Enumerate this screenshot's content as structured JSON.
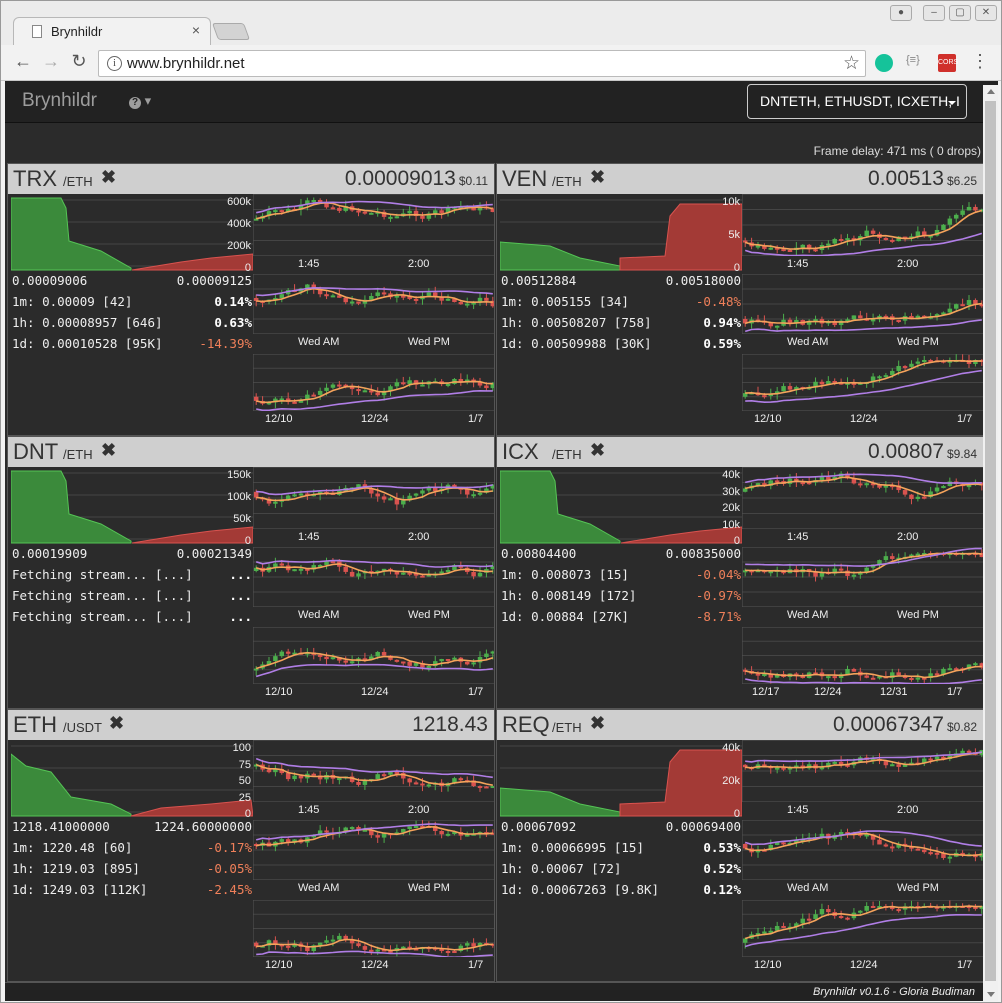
{
  "browser": {
    "tab_title": "Brynhildr",
    "url": "www.brynhildr.net",
    "cors_label": "CORS"
  },
  "app": {
    "brand": "Brynhildr",
    "pair_select": "DNTETH, ETHUSDT, ICXETH, I",
    "frame_delay": "Frame delay: 471 ms ( 0 drops)",
    "footer": "Brynhildr v0.1.6 - Gloria Budiman"
  },
  "colors": {
    "green": "#4cae4c",
    "red": "#d9534f",
    "orange": "#f5a35b",
    "purple": "#b07ee6",
    "depth_green": "#3b8a3b",
    "depth_red": "#a33a36"
  },
  "panels": [
    {
      "symbol": "TRX",
      "quote": "/ETH",
      "price": "0.00009013",
      "usd": "$0.11",
      "bid": "0.00009006",
      "ask": "0.00009125",
      "depth_axis": [
        "600k",
        "400k",
        "200k",
        "0"
      ],
      "depth_type": "bid-heavy",
      "stats": [
        {
          "label": "1m: 0.00009 [42]",
          "chg": "0.14%",
          "dir": "pos"
        },
        {
          "label": "1h: 0.00008957 [646]",
          "chg": "0.63%",
          "dir": "pos"
        },
        {
          "label": "1d: 0.00010528 [95K]",
          "chg": "-14.39%",
          "dir": "neg"
        }
      ],
      "x1": [
        "1:45",
        "2:00"
      ],
      "x2": [
        "Wed AM",
        "Wed PM"
      ],
      "x3": [
        "12/10",
        "12/24",
        "1/7"
      ]
    },
    {
      "symbol": "VEN",
      "quote": "/ETH",
      "price": "0.00513",
      "usd": "$6.25",
      "bid": "0.00512884",
      "ask": "0.00518000",
      "depth_axis": [
        "10k",
        "5k",
        "0"
      ],
      "depth_type": "ask-heavy",
      "stats": [
        {
          "label": "1m: 0.005155 [34]",
          "chg": "-0.48%",
          "dir": "neg"
        },
        {
          "label": "1h: 0.00508207 [758]",
          "chg": "0.94%",
          "dir": "pos"
        },
        {
          "label": "1d: 0.00509988 [30K]",
          "chg": "0.59%",
          "dir": "pos"
        }
      ],
      "x1": [
        "1:45",
        "2:00"
      ],
      "x2": [
        "Wed AM",
        "Wed PM"
      ],
      "x3": [
        "12/10",
        "12/24",
        "1/7"
      ]
    },
    {
      "symbol": "DNT",
      "quote": "/ETH",
      "price": "",
      "usd": "",
      "bid": "0.00019909",
      "ask": "0.00021349",
      "depth_axis": [
        "150k",
        "100k",
        "50k",
        "0"
      ],
      "depth_type": "bid-heavy",
      "stats": [
        {
          "label": "Fetching stream... [...]",
          "chg": "...",
          "dir": "pos"
        },
        {
          "label": "Fetching stream... [...]",
          "chg": "...",
          "dir": "pos"
        },
        {
          "label": "Fetching stream... [...]",
          "chg": "...",
          "dir": "pos"
        }
      ],
      "x1": [
        "1:45",
        "2:00"
      ],
      "x2": [
        "Wed AM",
        "Wed PM"
      ],
      "x3": [
        "12/10",
        "12/24",
        "1/7"
      ]
    },
    {
      "symbol": "ICX",
      "quote": "/ETH",
      "price": "0.00807",
      "usd": "$9.84",
      "bid": "0.00804400",
      "ask": "0.00835000",
      "depth_axis": [
        "40k",
        "30k",
        "20k",
        "10k",
        "0"
      ],
      "depth_type": "bid-heavy",
      "stats": [
        {
          "label": "1m: 0.008073 [15]",
          "chg": "-0.04%",
          "dir": "neg"
        },
        {
          "label": "1h: 0.008149 [172]",
          "chg": "-0.97%",
          "dir": "neg"
        },
        {
          "label": "1d: 0.00884 [27K]",
          "chg": "-8.71%",
          "dir": "neg"
        }
      ],
      "x1": [
        "1:45",
        "2:00"
      ],
      "x2": [
        "Wed AM",
        "Wed PM"
      ],
      "x3": [
        "12/17",
        "12/24",
        "12/31",
        "1/7"
      ]
    },
    {
      "symbol": "ETH",
      "quote": "/USDT",
      "price": "1218.43",
      "usd": "",
      "bid": "1218.41000000",
      "ask": "1224.60000000",
      "depth_axis": [
        "100",
        "75",
        "50",
        "25",
        "0"
      ],
      "depth_type": "balanced",
      "stats": [
        {
          "label": "1m: 1220.48 [60]",
          "chg": "-0.17%",
          "dir": "neg"
        },
        {
          "label": "1h: 1219.03 [895]",
          "chg": "-0.05%",
          "dir": "neg"
        },
        {
          "label": "1d: 1249.03 [112K]",
          "chg": "-2.45%",
          "dir": "neg"
        }
      ],
      "x1": [
        "1:45",
        "2:00"
      ],
      "x2": [
        "Wed AM",
        "Wed PM"
      ],
      "x3": [
        "12/10",
        "12/24",
        "1/7"
      ]
    },
    {
      "symbol": "REQ",
      "quote": "/ETH",
      "price": "0.00067347",
      "usd": "$0.82",
      "bid": "0.00067092",
      "ask": "0.00069400",
      "depth_axis": [
        "40k",
        "20k",
        "0"
      ],
      "depth_type": "ask-heavy",
      "stats": [
        {
          "label": "1m: 0.00066995 [15]",
          "chg": "0.53%",
          "dir": "pos"
        },
        {
          "label": "1h: 0.00067 [72]",
          "chg": "0.52%",
          "dir": "pos"
        },
        {
          "label": "1d: 0.00067263 [9.8K]",
          "chg": "0.12%",
          "dir": "pos"
        }
      ],
      "x1": [
        "1:45",
        "2:00"
      ],
      "x2": [
        "Wed AM",
        "Wed PM"
      ],
      "x3": [
        "12/10",
        "12/24",
        "1/7"
      ]
    }
  ]
}
